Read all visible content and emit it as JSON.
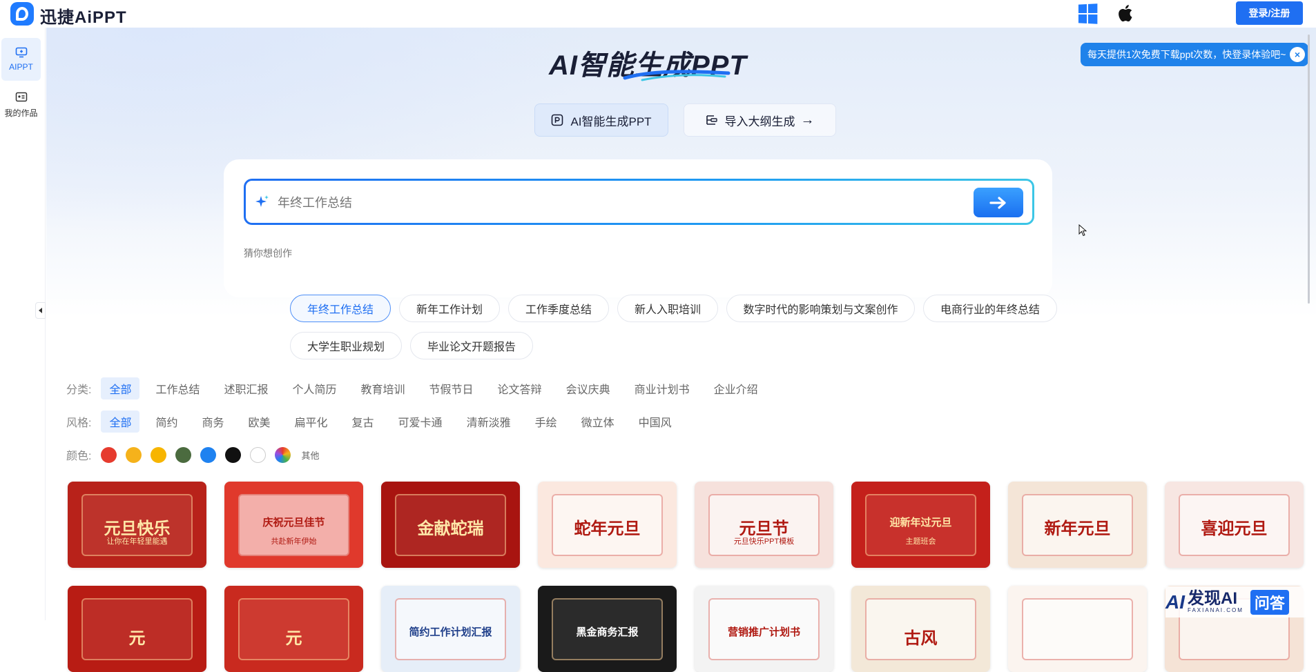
{
  "app": {
    "logo_text": "迅捷AiPPT",
    "login_label": "登录/注册",
    "os_icons": [
      "windows-icon",
      "apple-icon"
    ]
  },
  "sidebar": {
    "items": [
      {
        "label": "AIPPT",
        "icon": "ai-monitor-icon",
        "active": true
      },
      {
        "label": "我的作品",
        "icon": "works-card-icon",
        "active": false
      }
    ]
  },
  "hero": {
    "title": "AI智能生成PPT",
    "modes": [
      {
        "label": "AI智能生成PPT",
        "icon": "ppt-icon",
        "active": true
      },
      {
        "label": "导入大纲生成",
        "icon": "outline-icon",
        "arrow": "→",
        "active": false
      }
    ]
  },
  "search": {
    "placeholder": "年终工作总结",
    "value": ""
  },
  "suggestions": {
    "label": "猜你想创作",
    "items": [
      "年终工作总结",
      "新年工作计划",
      "工作季度总结",
      "新人入职培训",
      "数字时代的影响策划与文案创作",
      "电商行业的年终总结",
      "大学生职业规划",
      "毕业论文开题报告"
    ],
    "active_index": 0
  },
  "filters": {
    "category": {
      "label": "分类:",
      "options": [
        "全部",
        "工作总结",
        "述职汇报",
        "个人简历",
        "教育培训",
        "节假节日",
        "论文答辩",
        "会议庆典",
        "商业计划书",
        "企业介绍"
      ],
      "active_index": 0
    },
    "style": {
      "label": "风格:",
      "options": [
        "全部",
        "简约",
        "商务",
        "欧美",
        "扁平化",
        "复古",
        "可爱卡通",
        "清新淡雅",
        "手绘",
        "微立体",
        "中国风"
      ],
      "active_index": 0
    },
    "color": {
      "label": "颜色:",
      "swatches": [
        "#e63b2e",
        "#f5b21b",
        "#f7b500",
        "#4b6b3f",
        "#1f82f0",
        "#111111",
        "#ffffff"
      ],
      "other_label": "其他"
    }
  },
  "templates": {
    "row1": [
      {
        "title": "元旦快乐",
        "subtitle": "让你在年轻里能遇",
        "bg": "#b8221a"
      },
      {
        "title": "庆祝元旦佳节",
        "subtitle": "共赴新年伊始",
        "bg": "#e0392c"
      },
      {
        "title": "金献蛇瑞",
        "subtitle": "",
        "bg": "#a81410"
      },
      {
        "title": "蛇年元旦",
        "subtitle": "",
        "bg": "#fbe8df"
      },
      {
        "title": "元旦节",
        "subtitle": "元旦快乐PPT模板",
        "bg": "#f6e1dc"
      },
      {
        "title": "迎新年过元旦",
        "subtitle": "主题班会",
        "bg": "#c4201b"
      },
      {
        "title": "新年元旦",
        "subtitle": "",
        "bg": "#f4e5d7"
      },
      {
        "title": "喜迎元旦",
        "subtitle": "",
        "bg": "#f7e6e2"
      }
    ],
    "row2": [
      {
        "title": "元",
        "bg": "#b81c14"
      },
      {
        "title": "元",
        "bg": "#c92a1f"
      },
      {
        "title": "简约工作计划汇报",
        "bg": "#e6eef8"
      },
      {
        "title": "黑金商务汇报",
        "bg": "#1a1a1a"
      },
      {
        "title": "营销推广计划书",
        "bg": "#f3f3f3"
      },
      {
        "title": "古风",
        "bg": "#f3e8d8"
      },
      {
        "title": "",
        "bg": "#fbf4ef"
      },
      {
        "title": "",
        "bg": "#f5e3d6"
      }
    ]
  },
  "toast": {
    "text": "每天提供1次免费下载ppt次数，快登录体验吧~",
    "close": "×"
  },
  "watermark": {
    "ai": "AI",
    "name": "发现AI",
    "domain": "FAXIANAI.COM",
    "badge": "问答"
  }
}
